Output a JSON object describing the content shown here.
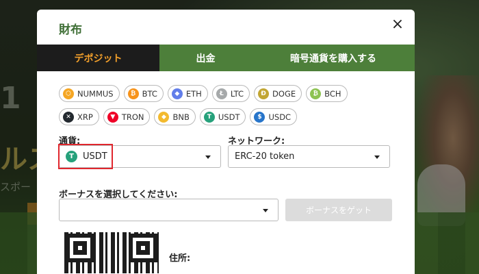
{
  "background": {
    "headline": "1",
    "subline": "ルス",
    "caption": "スポー"
  },
  "modal": {
    "title": "財布",
    "close_symbol": "×",
    "tabs": [
      {
        "label": "デポジット",
        "active": true
      },
      {
        "label": "出金",
        "active": false
      },
      {
        "label": "暗号通貨を購入する",
        "active": false
      }
    ],
    "currencies": [
      {
        "label": "NUMMUS",
        "icon": "nummus-icon",
        "color": "#f5a623",
        "glyph": "⬡"
      },
      {
        "label": "BTC",
        "icon": "btc-icon",
        "color": "#f7931a",
        "glyph": "₿"
      },
      {
        "label": "ETH",
        "icon": "eth-icon",
        "color": "#627eea",
        "glyph": "◆"
      },
      {
        "label": "LTC",
        "icon": "ltc-icon",
        "color": "#a6a9aa",
        "glyph": "Ł"
      },
      {
        "label": "DOGE",
        "icon": "doge-icon",
        "color": "#c2a633",
        "glyph": "Ð"
      },
      {
        "label": "BCH",
        "icon": "bch-icon",
        "color": "#8dc351",
        "glyph": "₿"
      },
      {
        "label": "XRP",
        "icon": "xrp-icon",
        "color": "#23292f",
        "glyph": "✕"
      },
      {
        "label": "TRON",
        "icon": "tron-icon",
        "color": "#ef0027",
        "glyph": "▼"
      },
      {
        "label": "BNB",
        "icon": "bnb-icon",
        "color": "#f3ba2f",
        "glyph": "◆"
      },
      {
        "label": "USDT",
        "icon": "usdt-icon",
        "color": "#26a17b",
        "glyph": "T"
      },
      {
        "label": "USDC",
        "icon": "usdc-icon",
        "color": "#2775ca",
        "glyph": "$"
      }
    ],
    "currency_field": {
      "label": "通貨:",
      "value": "USDT",
      "icon_glyph": "T"
    },
    "network_field": {
      "label": "ネットワーク:",
      "value": "ERC-20 token"
    },
    "bonus": {
      "label": "ボーナスを選択してください:",
      "value": "",
      "button": "ボーナスをゲット"
    },
    "address_label": "住所:"
  },
  "colors": {
    "accent_green": "#4d7f3a",
    "title_green": "#3f6f36",
    "active_tab_text": "#f3a02b",
    "highlight_red": "#e0262d"
  }
}
